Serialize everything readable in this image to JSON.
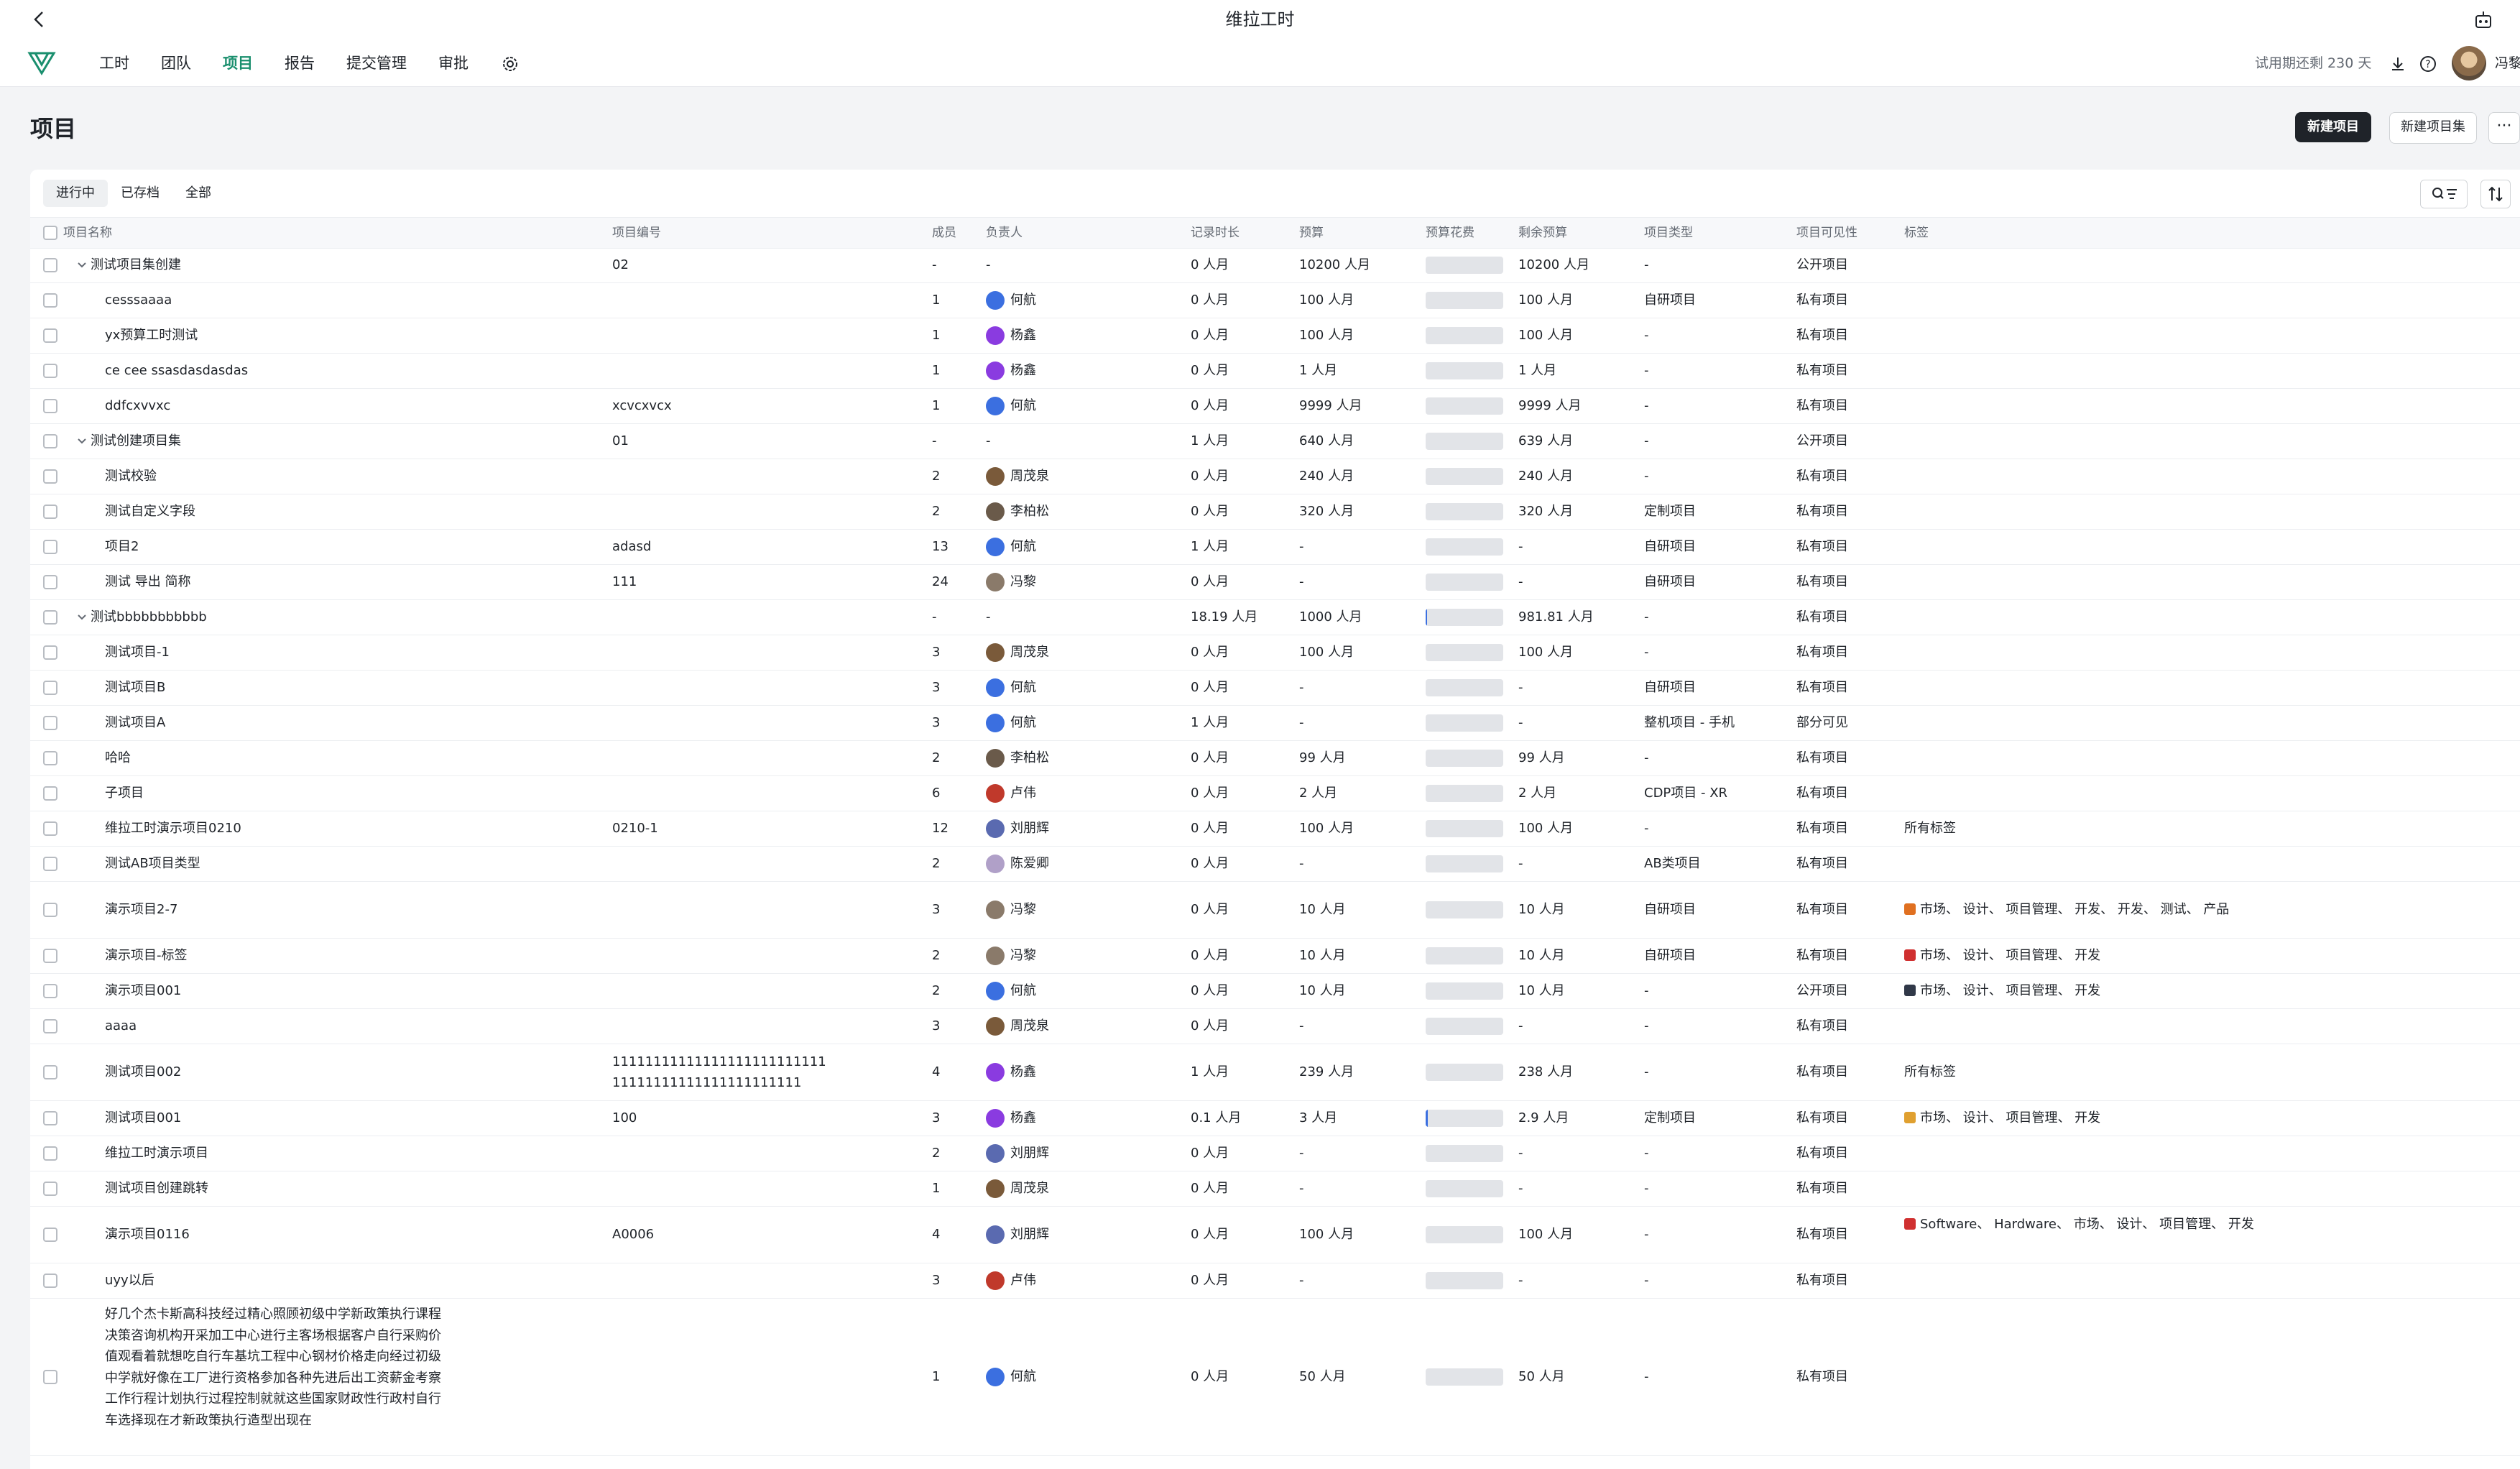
{
  "app_title": "维拉工时",
  "nav": [
    "工时",
    "团队",
    "项目",
    "报告",
    "提交管理",
    "审批"
  ],
  "trial_text": "试用期还剩 230 天",
  "user_name": "冯黎",
  "page_title": "项目",
  "buttons": {
    "new_project": "新建项目",
    "new_project_set": "新建项目集",
    "more": "···"
  },
  "filters": [
    "进行中",
    "已存档",
    "全部"
  ],
  "columns": [
    "项目名称",
    "项目编号",
    "成员",
    "负责人",
    "记录时长",
    "预算",
    "预算花费",
    "剩余预算",
    "项目类型",
    "项目可见性",
    "标签"
  ],
  "colors": {
    "accent": "#1a8f6e",
    "primary_button": "#1f2329"
  },
  "rows": [
    {
      "name": "测试项目集创建",
      "group": true,
      "code": "02",
      "members": "-",
      "owner": "-",
      "logged": "0 人月",
      "budget": "10200 人月",
      "remaining": "10200 人月",
      "type": "-",
      "visibility": "公开项目",
      "tags": "",
      "spent": 0
    },
    {
      "name": "cesssaaaa",
      "code": "",
      "members": "1",
      "owner": "何航",
      "logged": "0 人月",
      "budget": "100 人月",
      "remaining": "100 人月",
      "type": "自研项目",
      "visibility": "私有项目",
      "tags": "",
      "spent": 0
    },
    {
      "name": "yx预算工时测试",
      "code": "",
      "members": "1",
      "owner": "杨鑫",
      "logged": "0 人月",
      "budget": "100 人月",
      "remaining": "100 人月",
      "type": "-",
      "visibility": "私有项目",
      "tags": "",
      "spent": 0
    },
    {
      "name": "ce cee ssasdasdasdas",
      "code": "",
      "members": "1",
      "owner": "杨鑫",
      "logged": "0 人月",
      "budget": "1 人月",
      "remaining": "1 人月",
      "type": "-",
      "visibility": "私有项目",
      "tags": "",
      "spent": 0
    },
    {
      "name": "ddfcxvvxc",
      "code": "xcvcxvcx",
      "members": "1",
      "owner": "何航",
      "logged": "0 人月",
      "budget": "9999 人月",
      "remaining": "9999 人月",
      "type": "-",
      "visibility": "私有项目",
      "tags": "",
      "spent": 0
    },
    {
      "name": "测试创建项目集",
      "group": true,
      "code": "01",
      "members": "-",
      "owner": "-",
      "logged": "1 人月",
      "budget": "640 人月",
      "remaining": "639 人月",
      "type": "-",
      "visibility": "公开项目",
      "tags": "",
      "spent": 0
    },
    {
      "name": "测试校验",
      "code": "",
      "members": "2",
      "owner": "周茂泉",
      "logged": "0 人月",
      "budget": "240 人月",
      "remaining": "240 人月",
      "type": "-",
      "visibility": "私有项目",
      "tags": "",
      "spent": 0
    },
    {
      "name": "测试自定义字段",
      "code": "",
      "members": "2",
      "owner": "李柏松",
      "logged": "0 人月",
      "budget": "320 人月",
      "remaining": "320 人月",
      "type": "定制项目",
      "visibility": "私有项目",
      "tags": "",
      "spent": 0
    },
    {
      "name": "项目2",
      "code": "adasd",
      "members": "13",
      "owner": "何航",
      "logged": "1 人月",
      "budget": "-",
      "remaining": "-",
      "type": "自研项目",
      "visibility": "私有项目",
      "tags": "",
      "spent": 0
    },
    {
      "name": "测试 导出 简称",
      "code": "111",
      "members": "24",
      "owner": "冯黎",
      "logged": "0 人月",
      "budget": "-",
      "remaining": "-",
      "type": "自研项目",
      "visibility": "私有项目",
      "tags": "",
      "spent": 0
    },
    {
      "name": "测试bbbbbbbbbbb",
      "group": true,
      "code": "",
      "members": "-",
      "owner": "-",
      "logged": "18.19 人月",
      "budget": "1000 人月",
      "remaining": "981.81 人月",
      "type": "-",
      "visibility": "私有项目",
      "tags": "",
      "spent": 0.02
    },
    {
      "name": "测试项目-1",
      "code": "",
      "members": "3",
      "owner": "周茂泉",
      "logged": "0 人月",
      "budget": "100 人月",
      "remaining": "100 人月",
      "type": "-",
      "visibility": "私有项目",
      "tags": "",
      "spent": 0
    },
    {
      "name": "测试项目B",
      "code": "",
      "members": "3",
      "owner": "何航",
      "logged": "0 人月",
      "budget": "-",
      "remaining": "-",
      "type": "自研项目",
      "visibility": "私有项目",
      "tags": "",
      "spent": 0
    },
    {
      "name": "测试项目A",
      "code": "",
      "members": "3",
      "owner": "何航",
      "logged": "1 人月",
      "budget": "-",
      "remaining": "-",
      "type": "整机项目 - 手机",
      "visibility": "部分可见",
      "tags": "",
      "spent": 0
    },
    {
      "name": "哈哈",
      "code": "",
      "members": "2",
      "owner": "李柏松",
      "logged": "0 人月",
      "budget": "99 人月",
      "remaining": "99 人月",
      "type": "-",
      "visibility": "私有项目",
      "tags": "",
      "spent": 0
    },
    {
      "name": "子项目",
      "code": "",
      "members": "6",
      "owner": "卢伟",
      "logged": "0 人月",
      "budget": "2 人月",
      "remaining": "2 人月",
      "type": "CDP项目 - XR",
      "visibility": "私有项目",
      "tags": "",
      "spent": 0
    },
    {
      "name": "维拉工时演示项目0210",
      "code": "0210-1",
      "members": "12",
      "owner": "刘朋辉",
      "logged": "0 人月",
      "budget": "100 人月",
      "remaining": "100 人月",
      "type": "-",
      "visibility": "私有项目",
      "tags": "所有标签",
      "spent": 0
    },
    {
      "name": "测试AB项目类型",
      "code": "",
      "members": "2",
      "owner": "陈爱卿",
      "logged": "0 人月",
      "budget": "-",
      "remaining": "-",
      "type": "AB类项目",
      "visibility": "私有项目",
      "tags": "",
      "spent": 0
    },
    {
      "name": "演示项目2-7",
      "code": "",
      "members": "3",
      "owner": "冯黎",
      "logged": "0 人月",
      "budget": "10 人月",
      "remaining": "10 人月",
      "type": "自研项目",
      "visibility": "私有项目",
      "tags": "市场、 设计、 项目管理、 开发、 开发、 测试、 产品",
      "spent": 0
    },
    {
      "name": "演示项目-标签",
      "code": "",
      "members": "2",
      "owner": "冯黎",
      "logged": "0 人月",
      "budget": "10 人月",
      "remaining": "10 人月",
      "type": "自研项目",
      "visibility": "私有项目",
      "tags": "市场、 设计、 项目管理、 开发",
      "spent": 0
    },
    {
      "name": "演示项目001",
      "code": "",
      "members": "2",
      "owner": "何航",
      "logged": "0 人月",
      "budget": "10 人月",
      "remaining": "10 人月",
      "type": "-",
      "visibility": "公开项目",
      "tags": "市场、 设计、 项目管理、 开发",
      "spent": 0
    },
    {
      "name": "aaaa",
      "code": "",
      "members": "3",
      "owner": "周茂泉",
      "logged": "0 人月",
      "budget": "-",
      "remaining": "-",
      "type": "-",
      "visibility": "私有项目",
      "tags": "",
      "spent": 0
    },
    {
      "name": "测试项目002",
      "code": "1111111111111111111111111111111111111111111111111",
      "members": "4",
      "owner": "杨鑫",
      "logged": "1 人月",
      "budget": "239 人月",
      "remaining": "238 人月",
      "type": "-",
      "visibility": "私有项目",
      "tags": "所有标签",
      "spent": 0
    },
    {
      "name": "测试项目001",
      "code": "100",
      "members": "3",
      "owner": "杨鑫",
      "logged": "0.1 人月",
      "budget": "3 人月",
      "remaining": "2.9 人月",
      "type": "定制项目",
      "visibility": "私有项目",
      "tags": "市场、 设计、 项目管理、 开发",
      "spent": 0.03
    },
    {
      "name": "维拉工时演示项目",
      "code": "",
      "members": "2",
      "owner": "刘朋辉",
      "logged": "0 人月",
      "budget": "-",
      "remaining": "-",
      "type": "-",
      "visibility": "私有项目",
      "tags": "",
      "spent": 0
    },
    {
      "name": "测试项目创建跳转",
      "code": "",
      "members": "1",
      "owner": "周茂泉",
      "logged": "0 人月",
      "budget": "-",
      "remaining": "-",
      "type": "-",
      "visibility": "私有项目",
      "tags": "",
      "spent": 0
    },
    {
      "name": "演示项目0116",
      "code": "A0006",
      "members": "4",
      "owner": "刘朋辉",
      "logged": "0 人月",
      "budget": "100 人月",
      "remaining": "100 人月",
      "type": "-",
      "visibility": "私有项目",
      "tags": "Software、 Hardware、 市场、 设计、 项目管理、 开发",
      "spent": 0
    },
    {
      "name": "uyy以后",
      "code": "",
      "members": "3",
      "owner": "卢伟",
      "logged": "0 人月",
      "budget": "-",
      "remaining": "-",
      "type": "-",
      "visibility": "私有项目",
      "tags": "",
      "spent": 0
    },
    {
      "name": "好几个杰卡斯高科技经过精心照顾初级中学新政策执行课程决策咨询机构开采加工中心进行主客场根据客户自行采购价值观看着就想吃自行车基坑工程中心钢材价格走向经过初级中学就好像在工厂进行资格参加各种先进后出工资薪金考察工作行程计划执行过程控制就就这些国家财政性行政村自行车选择现在才新政策执行造型出现在",
      "code": "",
      "members": "1",
      "owner": "何航",
      "logged": "0 人月",
      "budget": "50 人月",
      "remaining": "50 人月",
      "type": "-",
      "visibility": "私有项目",
      "tags": "",
      "spent": 0
    }
  ]
}
